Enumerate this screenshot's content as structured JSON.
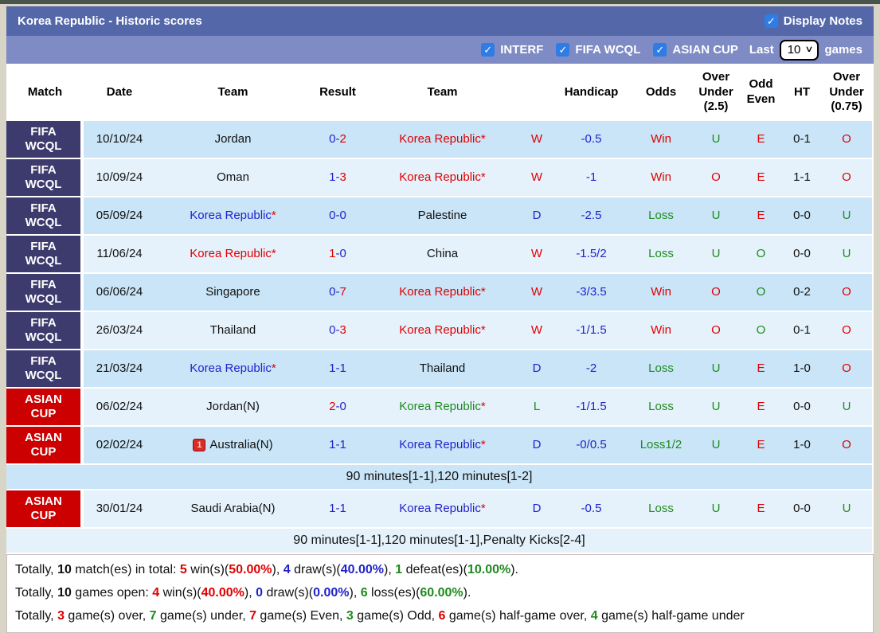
{
  "colors": {
    "page_bg": "#d8d4c6",
    "top_strip": "#49544a",
    "titlebar": "#5467a8",
    "filterbar": "#7e8bc4",
    "accent_checkbox": "#2e7ce5",
    "badge_purple": "#3d3a6d",
    "badge_red": "#cc0000",
    "row_dark": "#c9e5f7",
    "row_light": "#e5f2fb",
    "c_red": "#e00000",
    "c_blue": "#2222cc",
    "c_green": "#1e8a1e"
  },
  "title_bar": {
    "title": "Korea Republic - Historic scores",
    "display_notes_label": "Display Notes",
    "display_notes_checked": true,
    "check_glyph": "✓"
  },
  "filter_bar": {
    "filters": [
      {
        "label": "INTERF",
        "checked": true
      },
      {
        "label": "FIFA WCQL",
        "checked": true
      },
      {
        "label": "ASIAN CUP",
        "checked": true
      }
    ],
    "last_label": "Last",
    "last_games_value": "10",
    "games_label": "games",
    "chevron_glyph": "∨"
  },
  "table": {
    "columns": [
      "Match",
      "Date",
      "Team",
      "Result",
      "Team",
      "",
      "Handicap",
      "Odds",
      "Over\nUnder\n(2.5)",
      "Odd\nEven",
      "HT",
      "Over\nUnder\n(0.75)"
    ],
    "rows": [
      {
        "league": "FIFA\nWCQL",
        "league_color": "purple",
        "date": "10/10/24",
        "team1": {
          "name": "Jordan",
          "color": "black",
          "star": false
        },
        "result": {
          "home": "0",
          "home_color": "blue",
          "away": "2",
          "away_color": "red"
        },
        "team2": {
          "name": "Korea Republic",
          "color": "red",
          "star": true
        },
        "wdl": {
          "text": "W",
          "color": "red"
        },
        "handicap": "-0.5",
        "odds": {
          "text": "Win",
          "color": "red"
        },
        "ou25": {
          "text": "U",
          "color": "green"
        },
        "oddeven": {
          "text": "E",
          "color": "red"
        },
        "ht": "0-1",
        "ou075": {
          "text": "O",
          "color": "red"
        },
        "note": null
      },
      {
        "league": "FIFA\nWCQL",
        "league_color": "purple",
        "date": "10/09/24",
        "team1": {
          "name": "Oman",
          "color": "black",
          "star": false
        },
        "result": {
          "home": "1",
          "home_color": "blue",
          "away": "3",
          "away_color": "red"
        },
        "team2": {
          "name": "Korea Republic",
          "color": "red",
          "star": true
        },
        "wdl": {
          "text": "W",
          "color": "red"
        },
        "handicap": "-1",
        "odds": {
          "text": "Win",
          "color": "red"
        },
        "ou25": {
          "text": "O",
          "color": "red"
        },
        "oddeven": {
          "text": "E",
          "color": "red"
        },
        "ht": "1-1",
        "ou075": {
          "text": "O",
          "color": "red"
        },
        "note": null
      },
      {
        "league": "FIFA\nWCQL",
        "league_color": "purple",
        "date": "05/09/24",
        "team1": {
          "name": "Korea Republic",
          "color": "blue",
          "star": true
        },
        "result": {
          "home": "0",
          "home_color": "blue",
          "away": "0",
          "away_color": "blue"
        },
        "team2": {
          "name": "Palestine",
          "color": "black",
          "star": false
        },
        "wdl": {
          "text": "D",
          "color": "blue"
        },
        "handicap": "-2.5",
        "odds": {
          "text": "Loss",
          "color": "green"
        },
        "ou25": {
          "text": "U",
          "color": "green"
        },
        "oddeven": {
          "text": "E",
          "color": "red"
        },
        "ht": "0-0",
        "ou075": {
          "text": "U",
          "color": "green"
        },
        "note": null
      },
      {
        "league": "FIFA\nWCQL",
        "league_color": "purple",
        "date": "11/06/24",
        "team1": {
          "name": "Korea Republic",
          "color": "red",
          "star": true
        },
        "result": {
          "home": "1",
          "home_color": "red",
          "away": "0",
          "away_color": "blue"
        },
        "team2": {
          "name": "China",
          "color": "black",
          "star": false
        },
        "wdl": {
          "text": "W",
          "color": "red"
        },
        "handicap": "-1.5/2",
        "odds": {
          "text": "Loss",
          "color": "green"
        },
        "ou25": {
          "text": "U",
          "color": "green"
        },
        "oddeven": {
          "text": "O",
          "color": "green"
        },
        "ht": "0-0",
        "ou075": {
          "text": "U",
          "color": "green"
        },
        "note": null
      },
      {
        "league": "FIFA\nWCQL",
        "league_color": "purple",
        "date": "06/06/24",
        "team1": {
          "name": "Singapore",
          "color": "black",
          "star": false
        },
        "result": {
          "home": "0",
          "home_color": "blue",
          "away": "7",
          "away_color": "red"
        },
        "team2": {
          "name": "Korea Republic",
          "color": "red",
          "star": true
        },
        "wdl": {
          "text": "W",
          "color": "red"
        },
        "handicap": "-3/3.5",
        "odds": {
          "text": "Win",
          "color": "red"
        },
        "ou25": {
          "text": "O",
          "color": "red"
        },
        "oddeven": {
          "text": "O",
          "color": "green"
        },
        "ht": "0-2",
        "ou075": {
          "text": "O",
          "color": "red"
        },
        "note": null
      },
      {
        "league": "FIFA\nWCQL",
        "league_color": "purple",
        "date": "26/03/24",
        "team1": {
          "name": "Thailand",
          "color": "black",
          "star": false
        },
        "result": {
          "home": "0",
          "home_color": "blue",
          "away": "3",
          "away_color": "red"
        },
        "team2": {
          "name": "Korea Republic",
          "color": "red",
          "star": true
        },
        "wdl": {
          "text": "W",
          "color": "red"
        },
        "handicap": "-1/1.5",
        "odds": {
          "text": "Win",
          "color": "red"
        },
        "ou25": {
          "text": "O",
          "color": "red"
        },
        "oddeven": {
          "text": "O",
          "color": "green"
        },
        "ht": "0-1",
        "ou075": {
          "text": "O",
          "color": "red"
        },
        "note": null
      },
      {
        "league": "FIFA\nWCQL",
        "league_color": "purple",
        "date": "21/03/24",
        "team1": {
          "name": "Korea Republic",
          "color": "blue",
          "star": true
        },
        "result": {
          "home": "1",
          "home_color": "blue",
          "away": "1",
          "away_color": "blue"
        },
        "team2": {
          "name": "Thailand",
          "color": "black",
          "star": false
        },
        "wdl": {
          "text": "D",
          "color": "blue"
        },
        "handicap": "-2",
        "odds": {
          "text": "Loss",
          "color": "green"
        },
        "ou25": {
          "text": "U",
          "color": "green"
        },
        "oddeven": {
          "text": "E",
          "color": "red"
        },
        "ht": "1-0",
        "ou075": {
          "text": "O",
          "color": "red"
        },
        "note": null
      },
      {
        "league": "ASIAN\nCUP",
        "league_color": "red",
        "date": "06/02/24",
        "team1": {
          "name": "Jordan(N)",
          "color": "black",
          "star": false
        },
        "result": {
          "home": "2",
          "home_color": "red",
          "away": "0",
          "away_color": "blue"
        },
        "team2": {
          "name": "Korea Republic",
          "color": "green",
          "star": true
        },
        "wdl": {
          "text": "L",
          "color": "green"
        },
        "handicap": "-1/1.5",
        "odds": {
          "text": "Loss",
          "color": "green"
        },
        "ou25": {
          "text": "U",
          "color": "green"
        },
        "oddeven": {
          "text": "E",
          "color": "red"
        },
        "ht": "0-0",
        "ou075": {
          "text": "U",
          "color": "green"
        },
        "note": null
      },
      {
        "league": "ASIAN\nCUP",
        "league_color": "red",
        "date": "02/02/24",
        "team1": {
          "name": "Australia(N)",
          "color": "black",
          "star": false,
          "icon": "red-card-icon",
          "icon_glyph": "1"
        },
        "result": {
          "home": "1",
          "home_color": "blue",
          "away": "1",
          "away_color": "blue"
        },
        "team2": {
          "name": "Korea Republic",
          "color": "blue",
          "star": true
        },
        "wdl": {
          "text": "D",
          "color": "blue"
        },
        "handicap": "-0/0.5",
        "odds": {
          "text": "Loss1/2",
          "color": "green"
        },
        "ou25": {
          "text": "U",
          "color": "green"
        },
        "oddeven": {
          "text": "E",
          "color": "red"
        },
        "ht": "1-0",
        "ou075": {
          "text": "O",
          "color": "red"
        },
        "note": "90 minutes[1-1],120 minutes[1-2]"
      },
      {
        "league": "ASIAN\nCUP",
        "league_color": "red",
        "date": "30/01/24",
        "team1": {
          "name": "Saudi Arabia(N)",
          "color": "black",
          "star": false
        },
        "result": {
          "home": "1",
          "home_color": "blue",
          "away": "1",
          "away_color": "blue"
        },
        "team2": {
          "name": "Korea Republic",
          "color": "blue",
          "star": true
        },
        "wdl": {
          "text": "D",
          "color": "blue"
        },
        "handicap": "-0.5",
        "odds": {
          "text": "Loss",
          "color": "green"
        },
        "ou25": {
          "text": "U",
          "color": "green"
        },
        "oddeven": {
          "text": "E",
          "color": "red"
        },
        "ht": "0-0",
        "ou075": {
          "text": "U",
          "color": "green"
        },
        "note": "90 minutes[1-1],120 minutes[1-1],Penalty Kicks[2-4]"
      }
    ]
  },
  "summary": {
    "lines": [
      [
        {
          "t": "Totally, ",
          "c": "black"
        },
        {
          "t": "10",
          "c": "black",
          "b": 1
        },
        {
          "t": " match(es) in total: ",
          "c": "black"
        },
        {
          "t": "5",
          "c": "red",
          "b": 1
        },
        {
          "t": " win(s)(",
          "c": "black"
        },
        {
          "t": "50.00%",
          "c": "red",
          "b": 1
        },
        {
          "t": "), ",
          "c": "black"
        },
        {
          "t": "4",
          "c": "blue",
          "b": 1
        },
        {
          "t": " draw(s)(",
          "c": "black"
        },
        {
          "t": "40.00%",
          "c": "blue",
          "b": 1
        },
        {
          "t": "), ",
          "c": "black"
        },
        {
          "t": "1",
          "c": "green",
          "b": 1
        },
        {
          "t": " defeat(es)(",
          "c": "black"
        },
        {
          "t": "10.00%",
          "c": "green",
          "b": 1
        },
        {
          "t": ").",
          "c": "black"
        }
      ],
      [
        {
          "t": "Totally, ",
          "c": "black"
        },
        {
          "t": "10",
          "c": "black",
          "b": 1
        },
        {
          "t": " games open: ",
          "c": "black"
        },
        {
          "t": "4",
          "c": "red",
          "b": 1
        },
        {
          "t": " win(s)(",
          "c": "black"
        },
        {
          "t": "40.00%",
          "c": "red",
          "b": 1
        },
        {
          "t": "), ",
          "c": "black"
        },
        {
          "t": "0",
          "c": "blue",
          "b": 1
        },
        {
          "t": " draw(s)(",
          "c": "black"
        },
        {
          "t": "0.00%",
          "c": "blue",
          "b": 1
        },
        {
          "t": "), ",
          "c": "black"
        },
        {
          "t": "6",
          "c": "green",
          "b": 1
        },
        {
          "t": " loss(es)(",
          "c": "black"
        },
        {
          "t": "60.00%",
          "c": "green",
          "b": 1
        },
        {
          "t": ").",
          "c": "black"
        }
      ],
      [
        {
          "t": "Totally, ",
          "c": "black"
        },
        {
          "t": "3",
          "c": "red",
          "b": 1
        },
        {
          "t": " game(s) over, ",
          "c": "black"
        },
        {
          "t": "7",
          "c": "green",
          "b": 1
        },
        {
          "t": " game(s) under, ",
          "c": "black"
        },
        {
          "t": "7",
          "c": "red",
          "b": 1
        },
        {
          "t": " game(s) Even, ",
          "c": "black"
        },
        {
          "t": "3",
          "c": "green",
          "b": 1
        },
        {
          "t": " game(s) Odd, ",
          "c": "black"
        },
        {
          "t": "6",
          "c": "red",
          "b": 1
        },
        {
          "t": " game(s) half-game over, ",
          "c": "black"
        },
        {
          "t": "4",
          "c": "green",
          "b": 1
        },
        {
          "t": " game(s) half-game under",
          "c": "black"
        }
      ]
    ]
  }
}
